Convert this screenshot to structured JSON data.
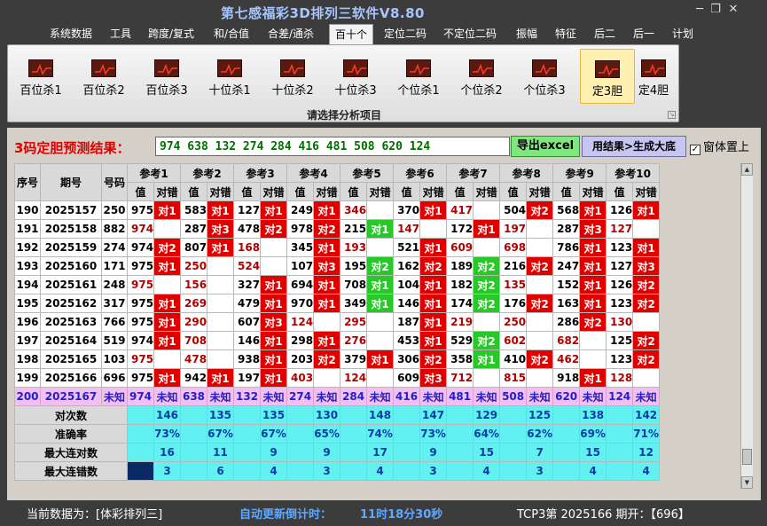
{
  "window": {
    "title": "第七感福彩3D排列三软件V8.80",
    "minimize_icon": "minimize-icon",
    "maximize_icon": "restore-icon",
    "close_icon": "close-icon"
  },
  "menu": [
    "系统数据",
    "工具",
    "跨度/复式",
    "和/合值",
    "合差/通杀",
    "百十个",
    "定位二码",
    "不定位二码",
    "振幅",
    "特征",
    "后二",
    "后一",
    "计划"
  ],
  "active_menu": "百十个",
  "ribbon": {
    "items": [
      "百位杀1",
      "百位杀2",
      "百位杀3",
      "十位杀1",
      "十位杀2",
      "十位杀3",
      "个位杀1",
      "个位杀2",
      "个位杀3",
      "定3胆",
      "定4胆"
    ],
    "selected": "定3胆",
    "caption": "请选择分析项目",
    "icon": "chart-icon"
  },
  "prediction": {
    "label": "3码定胆预测结果：",
    "value": "974 638 132 274 284 416 481 508 620 124",
    "export_button": "导出excel",
    "generate_button": "用结果>生成大底",
    "topmost_label": "窗体置上",
    "topmost_checked": true
  },
  "table": {
    "headers": {
      "seq": "序号",
      "period": "期号",
      "number": "号码",
      "value": "值",
      "mark": "对错"
    },
    "refs": [
      "参考1",
      "参考2",
      "参考3",
      "参考4",
      "参考5",
      "参考6",
      "参考7",
      "参考8",
      "参考9",
      "参考10"
    ],
    "rows": [
      {
        "seq": "190",
        "period": "2025157",
        "number": "250",
        "cells": [
          [
            "975",
            "对1"
          ],
          [
            "583",
            "对1"
          ],
          [
            "127",
            "对1"
          ],
          [
            "249",
            "对1"
          ],
          [
            "346",
            ""
          ],
          [
            "370",
            "对1"
          ],
          [
            "417",
            ""
          ],
          [
            "504",
            "对2"
          ],
          [
            "568",
            "对1"
          ],
          [
            "126",
            "对1"
          ]
        ]
      },
      {
        "seq": "191",
        "period": "2025158",
        "number": "882",
        "cells": [
          [
            "974",
            ""
          ],
          [
            "287",
            "对3"
          ],
          [
            "478",
            "对2"
          ],
          [
            "978",
            "对2"
          ],
          [
            "215",
            "对1"
          ],
          [
            "147",
            ""
          ],
          [
            "172",
            "对1"
          ],
          [
            "197",
            ""
          ],
          [
            "287",
            "对3"
          ],
          [
            "127",
            ""
          ]
        ]
      },
      {
        "seq": "192",
        "period": "2025159",
        "number": "274",
        "cells": [
          [
            "974",
            "对2"
          ],
          [
            "807",
            "对1"
          ],
          [
            "168",
            ""
          ],
          [
            "345",
            "对1"
          ],
          [
            "193",
            ""
          ],
          [
            "521",
            "对1"
          ],
          [
            "609",
            ""
          ],
          [
            "698",
            ""
          ],
          [
            "786",
            "对1"
          ],
          [
            "123",
            "对1"
          ]
        ]
      },
      {
        "seq": "193",
        "period": "2025160",
        "number": "171",
        "cells": [
          [
            "975",
            "对1"
          ],
          [
            "250",
            ""
          ],
          [
            "524",
            ""
          ],
          [
            "107",
            "对3"
          ],
          [
            "195",
            "对2"
          ],
          [
            "162",
            "对2"
          ],
          [
            "189",
            "对2"
          ],
          [
            "216",
            "对2"
          ],
          [
            "247",
            "对1"
          ],
          [
            "127",
            "对3"
          ]
        ]
      },
      {
        "seq": "194",
        "period": "2025161",
        "number": "248",
        "cells": [
          [
            "975",
            ""
          ],
          [
            "156",
            ""
          ],
          [
            "327",
            "对1"
          ],
          [
            "694",
            "对1"
          ],
          [
            "708",
            "对1"
          ],
          [
            "104",
            "对1"
          ],
          [
            "182",
            "对2"
          ],
          [
            "135",
            ""
          ],
          [
            "152",
            "对1"
          ],
          [
            "126",
            "对2"
          ]
        ]
      },
      {
        "seq": "195",
        "period": "2025162",
        "number": "317",
        "cells": [
          [
            "975",
            "对1"
          ],
          [
            "269",
            ""
          ],
          [
            "479",
            "对1"
          ],
          [
            "970",
            "对1"
          ],
          [
            "349",
            "对1"
          ],
          [
            "146",
            "对1"
          ],
          [
            "174",
            "对2"
          ],
          [
            "176",
            "对2"
          ],
          [
            "163",
            "对1"
          ],
          [
            "123",
            "对2"
          ]
        ]
      },
      {
        "seq": "196",
        "period": "2025163",
        "number": "766",
        "cells": [
          [
            "975",
            "对1"
          ],
          [
            "290",
            ""
          ],
          [
            "607",
            "对3"
          ],
          [
            "124",
            ""
          ],
          [
            "295",
            ""
          ],
          [
            "187",
            "对1"
          ],
          [
            "219",
            ""
          ],
          [
            "250",
            ""
          ],
          [
            "286",
            "对2"
          ],
          [
            "130",
            ""
          ]
        ]
      },
      {
        "seq": "197",
        "period": "2025164",
        "number": "519",
        "cells": [
          [
            "974",
            "对1"
          ],
          [
            "708",
            ""
          ],
          [
            "146",
            "对1"
          ],
          [
            "298",
            "对1"
          ],
          [
            "276",
            ""
          ],
          [
            "453",
            "对1"
          ],
          [
            "529",
            "对2"
          ],
          [
            "602",
            ""
          ],
          [
            "682",
            ""
          ],
          [
            "125",
            "对2"
          ]
        ]
      },
      {
        "seq": "198",
        "period": "2025165",
        "number": "103",
        "cells": [
          [
            "975",
            ""
          ],
          [
            "478",
            ""
          ],
          [
            "938",
            "对1"
          ],
          [
            "203",
            "对2"
          ],
          [
            "379",
            "对1"
          ],
          [
            "306",
            "对2"
          ],
          [
            "358",
            "对1"
          ],
          [
            "410",
            "对2"
          ],
          [
            "462",
            ""
          ],
          [
            "123",
            "对2"
          ]
        ]
      },
      {
        "seq": "199",
        "period": "2025166",
        "number": "696",
        "cells": [
          [
            "975",
            "对1"
          ],
          [
            "942",
            "对1"
          ],
          [
            "197",
            "对1"
          ],
          [
            "403",
            ""
          ],
          [
            "124",
            ""
          ],
          [
            "609",
            "对3"
          ],
          [
            "712",
            ""
          ],
          [
            "815",
            ""
          ],
          [
            "918",
            "对1"
          ],
          [
            "128",
            ""
          ]
        ]
      }
    ],
    "predict_row": {
      "seq": "200",
      "period": "2025167",
      "number": "未知",
      "cells": [
        [
          "974",
          "未知"
        ],
        [
          "638",
          "未知"
        ],
        [
          "132",
          "未知"
        ],
        [
          "274",
          "未知"
        ],
        [
          "284",
          "未知"
        ],
        [
          "416",
          "未知"
        ],
        [
          "481",
          "未知"
        ],
        [
          "508",
          "未知"
        ],
        [
          "620",
          "未知"
        ],
        [
          "124",
          "未知"
        ]
      ]
    },
    "stats": [
      {
        "label": "对次数",
        "values": [
          "146",
          "135",
          "135",
          "130",
          "148",
          "147",
          "129",
          "125",
          "138",
          "142"
        ]
      },
      {
        "label": "准确率",
        "values": [
          "73%",
          "67%",
          "67%",
          "65%",
          "74%",
          "73%",
          "64%",
          "62%",
          "69%",
          "71%"
        ]
      },
      {
        "label": "最大连对数",
        "values": [
          "16",
          "11",
          "9",
          "9",
          "17",
          "9",
          "15",
          "7",
          "15",
          "12"
        ]
      },
      {
        "label": "最大连错数",
        "values": [
          "3",
          "6",
          "4",
          "3",
          "4",
          "3",
          "4",
          "3",
          "4",
          "4"
        ]
      }
    ]
  },
  "status": {
    "current_data": "当前数据为：[体彩排列三]",
    "countdown_label": "自动更新倒计时：",
    "countdown_value": "11时18分30秒",
    "draw_info": "TCP3第 2025166 期开：【696】"
  },
  "colors": {
    "hit_red": "#e00000",
    "hit_green": "#27c827",
    "predict_pink": "#f4bff0",
    "stats_cyan": "#62f0f0",
    "title_blue": "#a6c4ff"
  }
}
